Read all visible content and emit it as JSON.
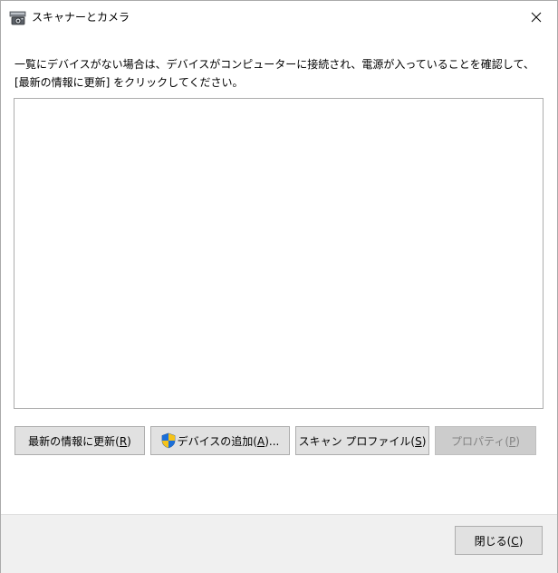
{
  "window": {
    "title": "スキャナーとカメラ",
    "close_glyph": "✕"
  },
  "instruction": {
    "line1": "一覧にデバイスがない場合は、デバイスがコンピューターに接続され、電源が入っていることを確認して、",
    "line2": "[最新の情報に更新] をクリックしてください。"
  },
  "device_list": {
    "items": []
  },
  "buttons": {
    "refresh": {
      "label": "最新の情報に更新(",
      "accel": "R",
      "suffix": ")"
    },
    "add_device": {
      "label": "デバイスの追加(",
      "accel": "A",
      "suffix": ")..."
    },
    "scan_profiles": {
      "label": "スキャン プロファイル(",
      "accel": "S",
      "suffix": ")"
    },
    "properties": {
      "label": "プロパティ(",
      "accel": "P",
      "suffix": ")"
    },
    "close": {
      "label": "閉じる(",
      "accel": "C",
      "suffix": ")"
    }
  },
  "icons": {
    "title": "scanner-camera-icon",
    "add_device": "uac-shield-icon",
    "close": "close-icon"
  },
  "colors": {
    "shield_blue": "#1c6fd8",
    "shield_yellow": "#f5c31a",
    "button_face": "#e1e1e1",
    "button_disabled": "#cccccc",
    "footer_bg": "#f0f0f0"
  }
}
